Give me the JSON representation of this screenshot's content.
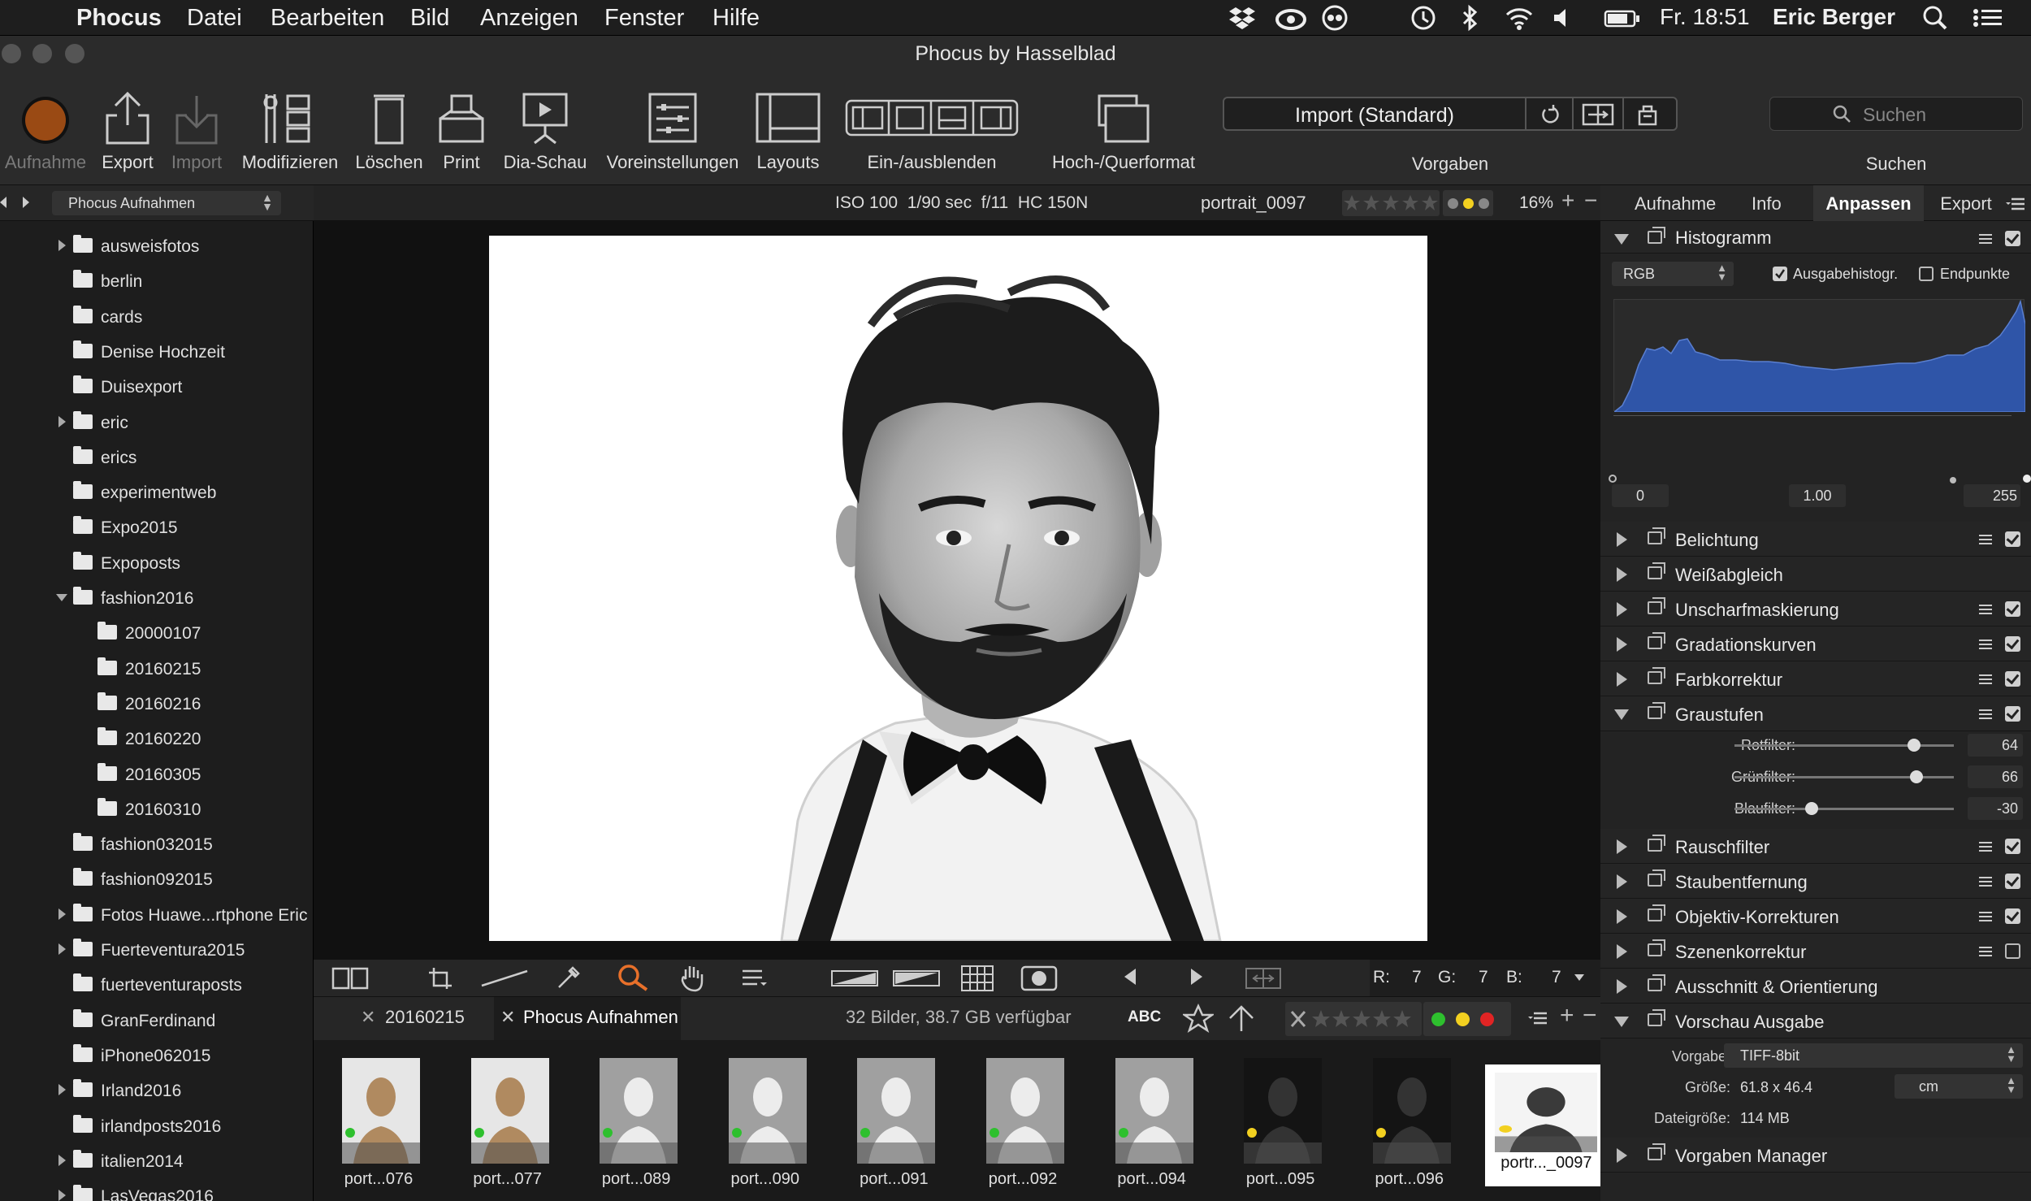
{
  "menubar": {
    "app": "Phocus",
    "items": [
      "Datei",
      "Bearbeiten",
      "Bild",
      "Anzeigen",
      "Fenster",
      "Hilfe"
    ],
    "clock": "Fr. 18:51",
    "user": "Eric Berger"
  },
  "window": {
    "title": "Phocus by Hasselblad"
  },
  "toolbar": {
    "aufnahme": "Aufnahme",
    "export": "Export",
    "import": "Import",
    "modifizieren": "Modifizieren",
    "loeschen": "Löschen",
    "print": "Print",
    "diaschau": "Dia-Schau",
    "voreinstellungen": "Voreinstellungen",
    "layouts": "Layouts",
    "einaus": "Ein-/ausblenden",
    "hochquer": "Hoch-/Querformat",
    "vorgaben_label": "Vorgaben",
    "vorgaben_value": "Import (Standard)",
    "suchen_label": "Suchen",
    "suchen_placeholder": "Suchen"
  },
  "leftbar": {
    "source": "Phocus Aufnahmen"
  },
  "infobar": {
    "exif": "ISO 100  1/90 sec  f/11  HC 150N",
    "filename": "portrait_0097",
    "zoom": "16%"
  },
  "tree": [
    {
      "name": "ausweisfotos",
      "level": 0,
      "arrow": "right"
    },
    {
      "name": "berlin",
      "level": 0,
      "arrow": ""
    },
    {
      "name": "cards",
      "level": 0,
      "arrow": ""
    },
    {
      "name": "Denise Hochzeit",
      "level": 0,
      "arrow": ""
    },
    {
      "name": "Duisexport",
      "level": 0,
      "arrow": ""
    },
    {
      "name": "eric",
      "level": 0,
      "arrow": "right"
    },
    {
      "name": "erics",
      "level": 0,
      "arrow": ""
    },
    {
      "name": "experimentweb",
      "level": 0,
      "arrow": ""
    },
    {
      "name": "Expo2015",
      "level": 0,
      "arrow": ""
    },
    {
      "name": "Expoposts",
      "level": 0,
      "arrow": ""
    },
    {
      "name": "fashion2016",
      "level": 0,
      "arrow": "down"
    },
    {
      "name": "20000107",
      "level": 1,
      "arrow": ""
    },
    {
      "name": "20160215",
      "level": 1,
      "arrow": ""
    },
    {
      "name": "20160216",
      "level": 1,
      "arrow": ""
    },
    {
      "name": "20160220",
      "level": 1,
      "arrow": ""
    },
    {
      "name": "20160305",
      "level": 1,
      "arrow": ""
    },
    {
      "name": "20160310",
      "level": 1,
      "arrow": ""
    },
    {
      "name": "fashion032015",
      "level": 0,
      "arrow": ""
    },
    {
      "name": "fashion092015",
      "level": 0,
      "arrow": ""
    },
    {
      "name": "Fotos Huawe...rtphone Eric",
      "level": 0,
      "arrow": "right"
    },
    {
      "name": "Fuerteventura2015",
      "level": 0,
      "arrow": "right"
    },
    {
      "name": "fuerteventuraposts",
      "level": 0,
      "arrow": ""
    },
    {
      "name": "GranFerdinand",
      "level": 0,
      "arrow": ""
    },
    {
      "name": "iPhone062015",
      "level": 0,
      "arrow": ""
    },
    {
      "name": "Irland2016",
      "level": 0,
      "arrow": "right"
    },
    {
      "name": "irlandposts2016",
      "level": 0,
      "arrow": ""
    },
    {
      "name": "italien2014",
      "level": 0,
      "arrow": "right"
    },
    {
      "name": "LasVegas2016",
      "level": 0,
      "arrow": "right"
    }
  ],
  "rgb_readout": {
    "r_label": "R:",
    "r": "7",
    "g_label": "G:",
    "g": "7",
    "b_label": "B:",
    "b": "7"
  },
  "browser": {
    "tab1": "20160215",
    "tab2": "Phocus Aufnahmen",
    "status": "32 Bilder, 38.7 GB verfügbar",
    "abc": "ABC"
  },
  "thumbnails": [
    {
      "label": "port...076",
      "tone": "light"
    },
    {
      "label": "port...077",
      "tone": "light"
    },
    {
      "label": "port...089",
      "tone": "mid"
    },
    {
      "label": "port...090",
      "tone": "mid"
    },
    {
      "label": "port...091",
      "tone": "mid"
    },
    {
      "label": "port...092",
      "tone": "mid"
    },
    {
      "label": "port...094",
      "tone": "mid"
    },
    {
      "label": "port...095",
      "tone": "dark"
    },
    {
      "label": "port...096",
      "tone": "dark"
    },
    {
      "label": "portr..._0097",
      "tone": "selected"
    }
  ],
  "rtabs": [
    "Aufnahme",
    "Info",
    "Anpassen",
    "Export"
  ],
  "histogram": {
    "title": "Histogramm",
    "channel": "RGB",
    "opt1": "Ausgabehistogr.",
    "opt2": "Endpunkte",
    "min": "0",
    "mid": "1.00",
    "max": "255"
  },
  "sections": {
    "belichtung": "Belichtung",
    "weiss": "Weißabgleich",
    "unscharf": "Unscharfmaskierung",
    "gradation": "Gradationskurven",
    "farbe": "Farbkorrektur",
    "grau": "Graustufen",
    "rausch": "Rauschfilter",
    "staub": "Staubentfernung",
    "objektiv": "Objektiv-Korrekturen",
    "szenen": "Szenenkorrektur",
    "ausschnitt": "Ausschnitt & Orientierung",
    "vorschau": "Vorschau Ausgabe",
    "manager": "Vorgaben Manager"
  },
  "graustufen": {
    "rot_label": "Rotfilter:",
    "rot": "64",
    "rot_frac": 0.82,
    "gruen_label": "Grünfilter:",
    "gruen": "66",
    "gruen_frac": 0.83,
    "blau_label": "Blaufilter:",
    "blau": "-30",
    "blau_frac": 0.35
  },
  "vorschau": {
    "vorgabe_label": "Vorgabe:",
    "vorgabe": "TIFF-8bit",
    "groesse_label": "Größe:",
    "groesse": "61.8 x 46.4",
    "unit": "cm",
    "datei_label": "Dateigröße:",
    "datei": "114 MB"
  },
  "colors": {
    "accent": "#e8702a",
    "histogram_fill": "#2f55a8"
  }
}
